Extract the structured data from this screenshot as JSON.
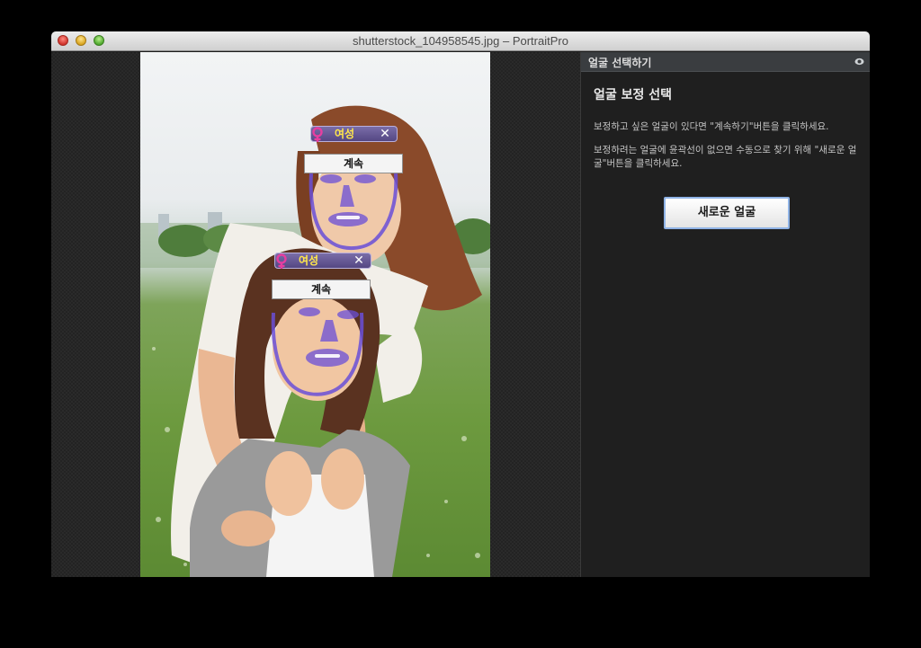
{
  "window": {
    "title": "shutterstock_104958545.jpg – PortraitPro"
  },
  "faces": [
    {
      "gender_label": "여성",
      "continue_label": "계속",
      "remove_symbol": "✕"
    },
    {
      "gender_label": "여성",
      "continue_label": "계속",
      "remove_symbol": "✕"
    }
  ],
  "panel": {
    "header_title": "얼굴 선택하기",
    "help_icon": "eye-icon",
    "section_title": "얼굴 보정 선택",
    "instruction_1": "보정하고 싶은 얼굴이 있다면 \"계속하기\"버튼을 클릭하세요.",
    "instruction_2": "보정하려는 얼굴에 윤곽선이 없으면 수동으로 찾기 위해 \"새로운 얼굴\"버튼을 클릭하세요.",
    "new_face_button": "새로운 얼굴"
  },
  "colors": {
    "face_outline": "#6a4fd8",
    "tag_background": "#5a4c8c",
    "gender_label": "#ffe74a",
    "female_icon": "#e63ea0",
    "button_focus_border": "#8fb3e6"
  }
}
